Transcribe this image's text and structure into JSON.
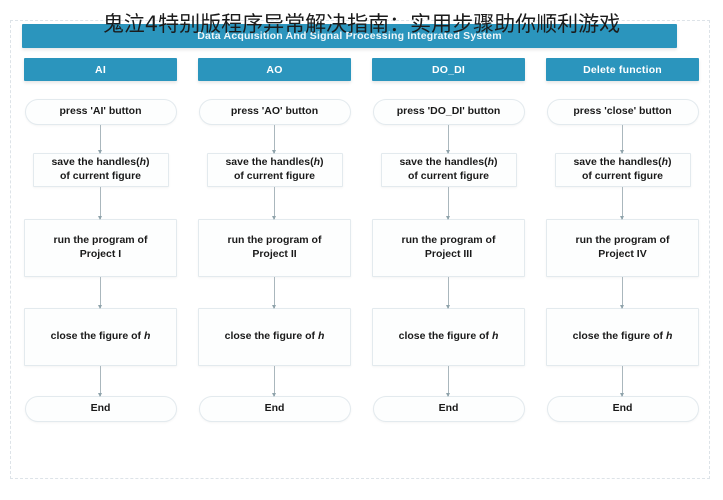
{
  "header": {
    "system_title": "Data Acquisition And Signal Processing Integrated System",
    "overlay_caption": "鬼泣4特别版程序异常解决指南：实用步骤助你顺利游戏",
    "bar_color": "#2b95bd"
  },
  "columns": [
    {
      "header_label": "AI",
      "steps": {
        "press": "press 'AI' button",
        "save_line1": "save the handles(",
        "save_var": "h",
        "save_line1_end": ")",
        "save_line2": "of current figure",
        "run_line1": "run the program of",
        "run_line2": "Project I",
        "close_text": "close the figure of ",
        "close_var": "h",
        "end": "End"
      }
    },
    {
      "header_label": "AO",
      "steps": {
        "press": "press 'AO' button",
        "save_line1": "save the handles(",
        "save_var": "h",
        "save_line1_end": ")",
        "save_line2": "of current figure",
        "run_line1": "run the program of",
        "run_line2": "Project II",
        "close_text": "close the figure of ",
        "close_var": "h",
        "end": "End"
      }
    },
    {
      "header_label": "DO_DI",
      "steps": {
        "press": "press 'DO_DI' button",
        "save_line1": "save the handles(",
        "save_var": "h",
        "save_line1_end": ")",
        "save_line2": "of current figure",
        "run_line1": "run the program of",
        "run_line2": "Project III",
        "close_text": "close the figure of ",
        "close_var": "h",
        "end": "End"
      }
    },
    {
      "header_label": "Delete function",
      "steps": {
        "press": "press 'close' button",
        "save_line1": "save the handles(",
        "save_var": "h",
        "save_line1_end": ")",
        "save_line2": "of current figure",
        "run_line1": "run the program of",
        "run_line2": "Project IV",
        "close_text": "close the figure of ",
        "close_var": "h",
        "end": "End"
      }
    }
  ]
}
